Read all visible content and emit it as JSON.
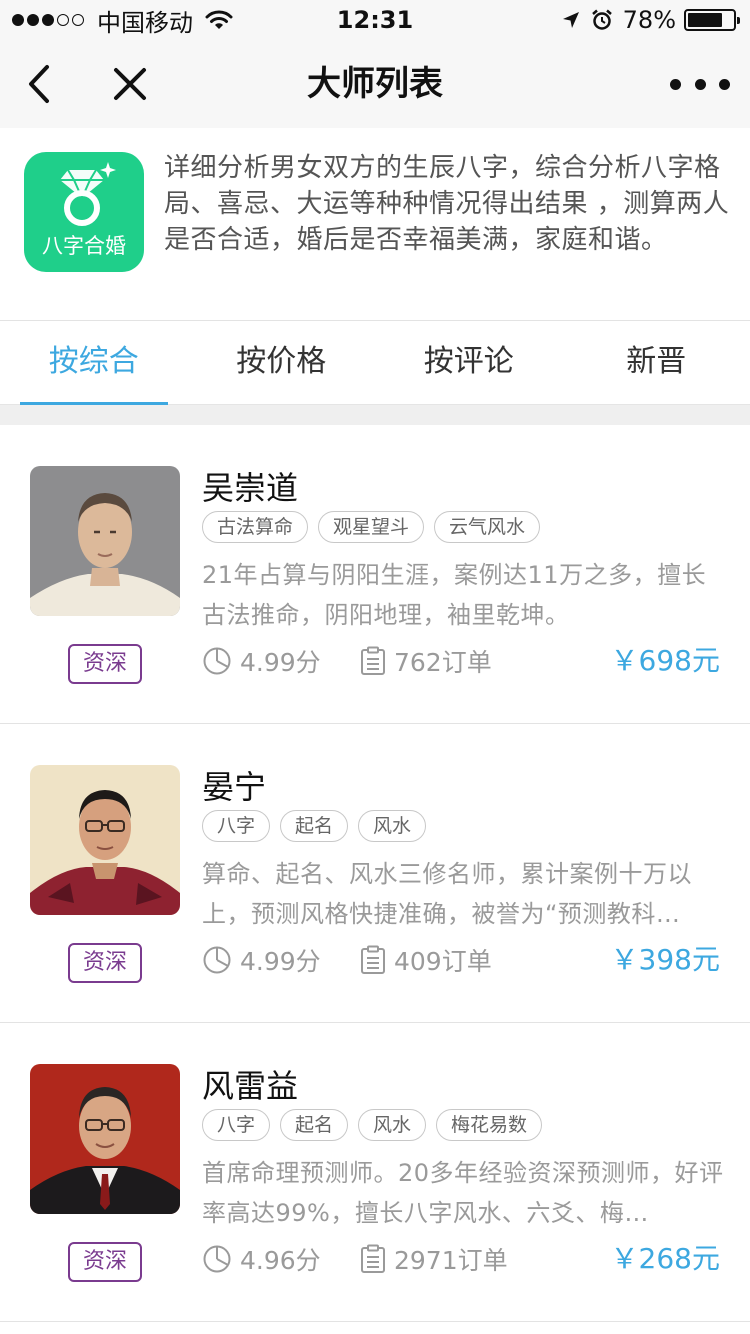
{
  "status_bar": {
    "carrier": "中国移动",
    "time": "12:31",
    "battery_percent": "78%",
    "battery_level": 0.78,
    "signal_bars_filled": 3,
    "signal_bars_total": 5
  },
  "nav": {
    "title": "大师列表",
    "back_icon": "chevron-left-icon",
    "close_icon": "close-icon",
    "more_icon": "more-dots-icon"
  },
  "intro": {
    "app_icon_label": "八字合婚",
    "app_icon_color": "#1fcf8a",
    "description": "详细分析男女双方的生辰八字，综合分析八字格局、喜忌、大运等种种情况得出结果 ，测算两人是否合适，婚后是否幸福美满，家庭和谐。"
  },
  "tabs": [
    {
      "label": "按综合",
      "active": true
    },
    {
      "label": "按价格",
      "active": false
    },
    {
      "label": "按评论",
      "active": false
    },
    {
      "label": "新晋",
      "active": false
    }
  ],
  "accent_color": "#3da8e0",
  "badge_color": "#7a3b8f",
  "masters": [
    {
      "name": "吴崇道",
      "tags": [
        "古法算命",
        "观星望斗",
        "云气风水"
      ],
      "description": "21年占算与阴阳生涯，案例达11万之多，擅长古法推命，阴阳地理，袖里乾坤。",
      "badge": "资深",
      "score": "4.99分",
      "orders": "762订单",
      "price": "￥698元"
    },
    {
      "name": "晏宁",
      "tags": [
        "八字",
        "起名",
        "风水"
      ],
      "description": "算命、起名、风水三修名师，累计案例十万以上，预测风格快捷准确，被誉为“预测教科…",
      "badge": "资深",
      "score": "4.99分",
      "orders": "409订单",
      "price": "￥398元"
    },
    {
      "name": "风雷益",
      "tags": [
        "八字",
        "起名",
        "风水",
        "梅花易数"
      ],
      "description": "首席命理预测师。20多年经验资深预测师，好评率高达99%，擅长八字风水、六爻、梅…",
      "badge": "资深",
      "score": "4.96分",
      "orders": "2971订单",
      "price": "￥268元"
    }
  ]
}
